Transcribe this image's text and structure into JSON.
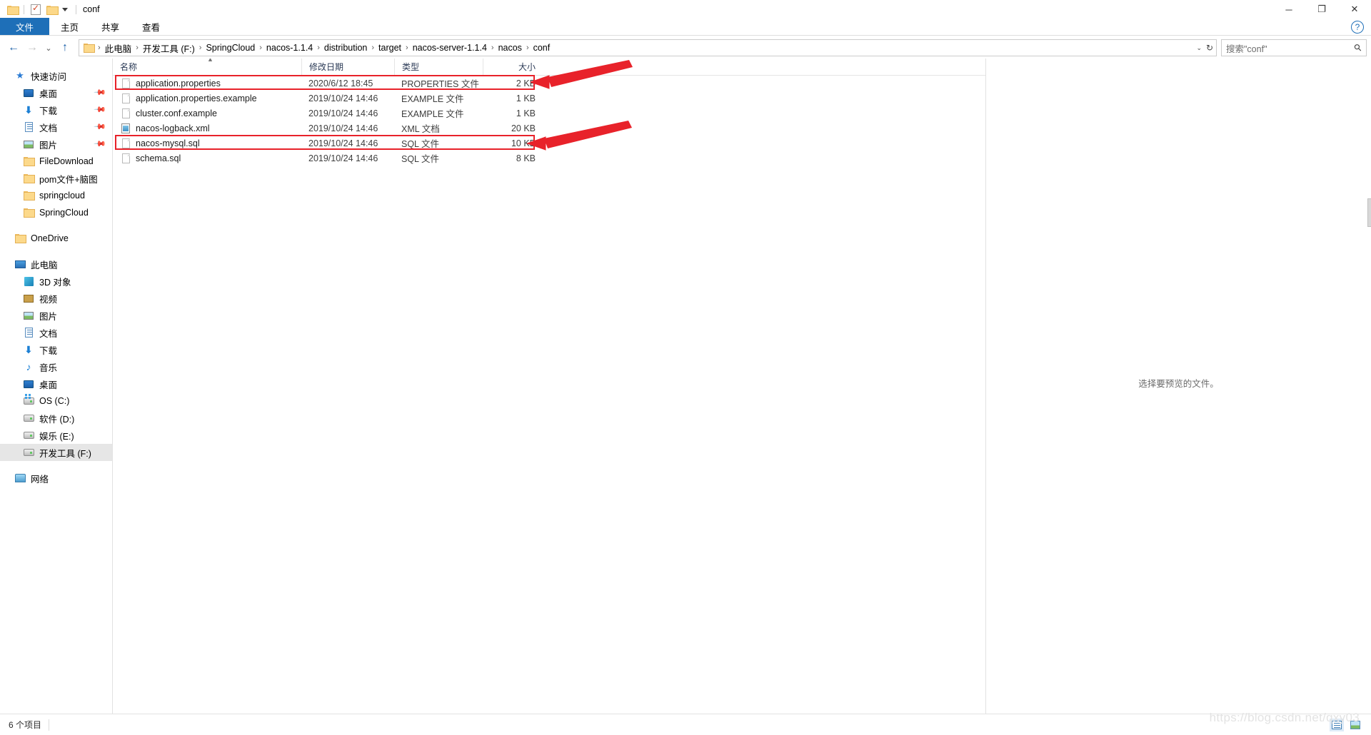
{
  "window": {
    "title": "conf",
    "quick_access_tools": [
      "folder-icon",
      "properties-icon",
      "new-folder-icon"
    ],
    "controls": {
      "minimize": "─",
      "maximize": "❐",
      "close": "✕"
    }
  },
  "ribbon": {
    "tabs": [
      {
        "label": "文件",
        "active": true
      },
      {
        "label": "主页",
        "active": false
      },
      {
        "label": "共享",
        "active": false
      },
      {
        "label": "查看",
        "active": false
      }
    ],
    "help_label": "?"
  },
  "addressbar": {
    "back": "←",
    "forward": "→",
    "recent": "⌄",
    "up": "↑",
    "crumbs": [
      "此电脑",
      "开发工具 (F:)",
      "SpringCloud",
      "nacos-1.1.4",
      "distribution",
      "target",
      "nacos-server-1.1.4",
      "nacos",
      "conf"
    ],
    "separator": "›",
    "dropdown": "⌄",
    "refresh": "↻"
  },
  "search": {
    "placeholder": "搜索\"conf\"",
    "icon": "search-icon"
  },
  "sidebar": {
    "groups": [
      {
        "name": "quick-access",
        "header": {
          "label": "快速访问",
          "icon": "star-pin-icon"
        },
        "items": [
          {
            "label": "桌面",
            "icon": "desktop-icon",
            "pinned": true
          },
          {
            "label": "下载",
            "icon": "downloads-icon",
            "pinned": true
          },
          {
            "label": "文档",
            "icon": "documents-icon",
            "pinned": true
          },
          {
            "label": "图片",
            "icon": "pictures-icon",
            "pinned": true
          },
          {
            "label": "FileDownload",
            "icon": "folder-icon",
            "pinned": false
          },
          {
            "label": "pom文件+脑图",
            "icon": "folder-icon",
            "pinned": false
          },
          {
            "label": "springcloud",
            "icon": "folder-icon",
            "pinned": false
          },
          {
            "label": "SpringCloud",
            "icon": "folder-icon",
            "pinned": false
          }
        ]
      },
      {
        "name": "onedrive",
        "header": {
          "label": "OneDrive",
          "icon": "folder-icon"
        },
        "items": []
      },
      {
        "name": "this-pc",
        "header": {
          "label": "此电脑",
          "icon": "pc-icon"
        },
        "items": [
          {
            "label": "3D 对象",
            "icon": "3d-objects-icon"
          },
          {
            "label": "视频",
            "icon": "videos-icon"
          },
          {
            "label": "图片",
            "icon": "pictures-icon"
          },
          {
            "label": "文档",
            "icon": "documents-icon"
          },
          {
            "label": "下载",
            "icon": "downloads-icon"
          },
          {
            "label": "音乐",
            "icon": "music-icon"
          },
          {
            "label": "桌面",
            "icon": "desktop-icon"
          },
          {
            "label": "OS (C:)",
            "icon": "os-drive-icon"
          },
          {
            "label": "软件 (D:)",
            "icon": "drive-icon"
          },
          {
            "label": "娱乐 (E:)",
            "icon": "drive-icon"
          },
          {
            "label": "开发工具 (F:)",
            "icon": "drive-icon",
            "selected": true
          }
        ]
      },
      {
        "name": "network",
        "header": {
          "label": "网络",
          "icon": "network-icon"
        },
        "items": []
      }
    ]
  },
  "filelist": {
    "columns": [
      {
        "key": "name",
        "label": "名称",
        "sorted": true,
        "sort_dir": "asc"
      },
      {
        "key": "date",
        "label": "修改日期"
      },
      {
        "key": "type",
        "label": "类型"
      },
      {
        "key": "size",
        "label": "大小"
      }
    ],
    "rows": [
      {
        "name": "application.properties",
        "date": "2020/6/12 18:45",
        "type": "PROPERTIES 文件",
        "size": "2 KB",
        "icon": "generic-file-icon",
        "highlighted": true
      },
      {
        "name": "application.properties.example",
        "date": "2019/10/24 14:46",
        "type": "EXAMPLE 文件",
        "size": "1 KB",
        "icon": "generic-file-icon",
        "highlighted": false
      },
      {
        "name": "cluster.conf.example",
        "date": "2019/10/24 14:46",
        "type": "EXAMPLE 文件",
        "size": "1 KB",
        "icon": "generic-file-icon",
        "highlighted": false
      },
      {
        "name": "nacos-logback.xml",
        "date": "2019/10/24 14:46",
        "type": "XML 文档",
        "size": "20 KB",
        "icon": "xml-file-icon",
        "highlighted": false
      },
      {
        "name": "nacos-mysql.sql",
        "date": "2019/10/24 14:46",
        "type": "SQL 文件",
        "size": "10 KB",
        "icon": "generic-file-icon",
        "highlighted": true
      },
      {
        "name": "schema.sql",
        "date": "2019/10/24 14:46",
        "type": "SQL 文件",
        "size": "8 KB",
        "icon": "generic-file-icon",
        "highlighted": false
      }
    ]
  },
  "preview": {
    "message": "选择要预览的文件。"
  },
  "statusbar": {
    "item_count": "6 个项目",
    "views": [
      {
        "name": "details-view",
        "active": true
      },
      {
        "name": "thumbnails-view",
        "active": false
      }
    ]
  },
  "annotations": {
    "accent_color": "#e8222a",
    "watermark": "https://blog.csdn.net/qxy03"
  }
}
